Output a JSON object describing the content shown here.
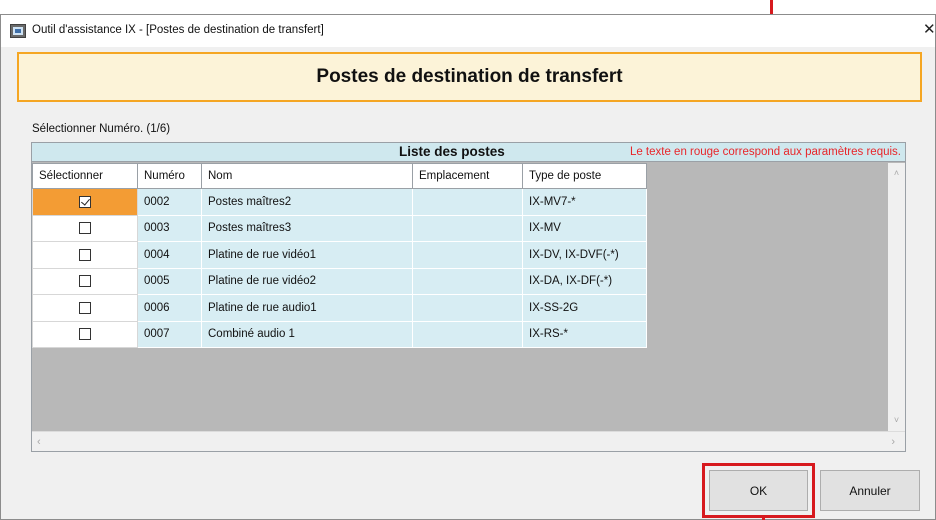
{
  "window": {
    "title": "Outil d'assistance IX - [Postes de destination de transfert]",
    "close_symbol": "✕"
  },
  "header": {
    "title": "Postes de destination de transfert"
  },
  "selection_label": "Sélectionner Numéro. (1/6)",
  "list": {
    "title": "Liste des postes",
    "note": "Le texte en rouge correspond aux paramètres requis.",
    "columns": [
      "Sélectionner",
      "Numéro",
      "Nom",
      "Emplacement",
      "Type de poste"
    ],
    "rows": [
      {
        "selected": true,
        "numero": "0002",
        "nom": "Postes maîtres2",
        "emplacement": "",
        "type": "IX-MV7-*"
      },
      {
        "selected": false,
        "numero": "0003",
        "nom": "Postes maîtres3",
        "emplacement": "",
        "type": "IX-MV"
      },
      {
        "selected": false,
        "numero": "0004",
        "nom": "Platine de rue vidéo1",
        "emplacement": "",
        "type": "IX-DV, IX-DVF(-*)"
      },
      {
        "selected": false,
        "numero": "0005",
        "nom": "Platine de rue vidéo2",
        "emplacement": "",
        "type": "IX-DA, IX-DF(-*)"
      },
      {
        "selected": false,
        "numero": "0006",
        "nom": "Platine de rue audio1",
        "emplacement": "",
        "type": "IX-SS-2G"
      },
      {
        "selected": false,
        "numero": "0007",
        "nom": "Combiné audio 1",
        "emplacement": "",
        "type": "IX-RS-*"
      }
    ]
  },
  "buttons": {
    "ok": "OK",
    "cancel": "Annuler"
  },
  "colors": {
    "header_border": "#f5a623",
    "header_background": "#fcf3d8",
    "highlight_red": "#d7191e",
    "required_text": "#e8262a",
    "row_background": "#d7edf3",
    "selected_cell": "#f39c34"
  },
  "icons": {
    "app": "app-window-icon",
    "close": "close-icon",
    "checkbox_checked": "checkbox-checked-icon",
    "checkbox_unchecked": "checkbox-unchecked-icon",
    "scroll_up": "chevron-up-icon",
    "scroll_down": "chevron-down-icon",
    "scroll_left": "chevron-left-icon",
    "scroll_right": "chevron-right-icon"
  }
}
